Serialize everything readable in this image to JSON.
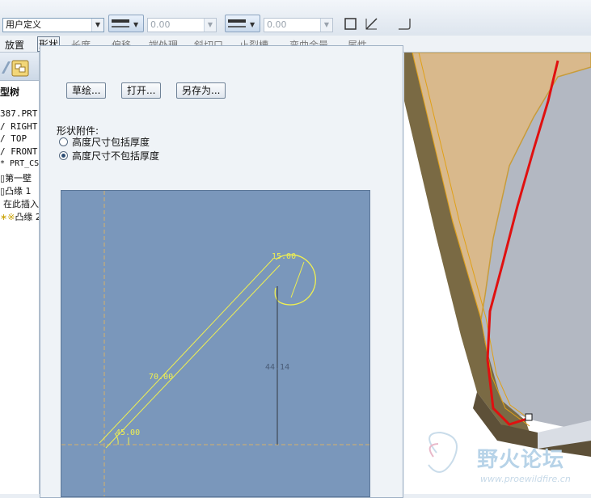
{
  "toolbar": {
    "type_select": "用户定义",
    "value1": "0.00",
    "value2": "0.00"
  },
  "menu": {
    "tabs": [
      "放置",
      "形状",
      "长度",
      "偏移",
      "端处理",
      "斜切口",
      "止裂槽",
      "弯曲余量",
      "属性"
    ],
    "active_tab": "形状"
  },
  "tree": {
    "title": "型树",
    "items": [
      "387.PRT",
      "RIGHT",
      "TOP",
      "FRONT",
      "PRT_CSY",
      "第一壁",
      "凸缘 1",
      "在此插入",
      "凸缘 2"
    ]
  },
  "panel": {
    "buttons": {
      "sketch": "草绘...",
      "open": "打开...",
      "save_as": "另存为..."
    },
    "attach_label": "形状附件:",
    "radio_options": [
      "高度尺寸包括厚度",
      "高度尺寸不包括厚度"
    ],
    "selected_option_index": 1
  },
  "sketch": {
    "dims": {
      "radius": "15.00",
      "length": "70.00",
      "height": "44.14",
      "angle": "45.00"
    }
  },
  "watermark": {
    "logo": "野火论坛",
    "url": "www.proewildfire.cn"
  },
  "colors": {
    "sketch_bg": "#7a97bb",
    "sketch_line": "#f0f050",
    "curve": "#e01010",
    "sheet": "#d9b98c"
  }
}
